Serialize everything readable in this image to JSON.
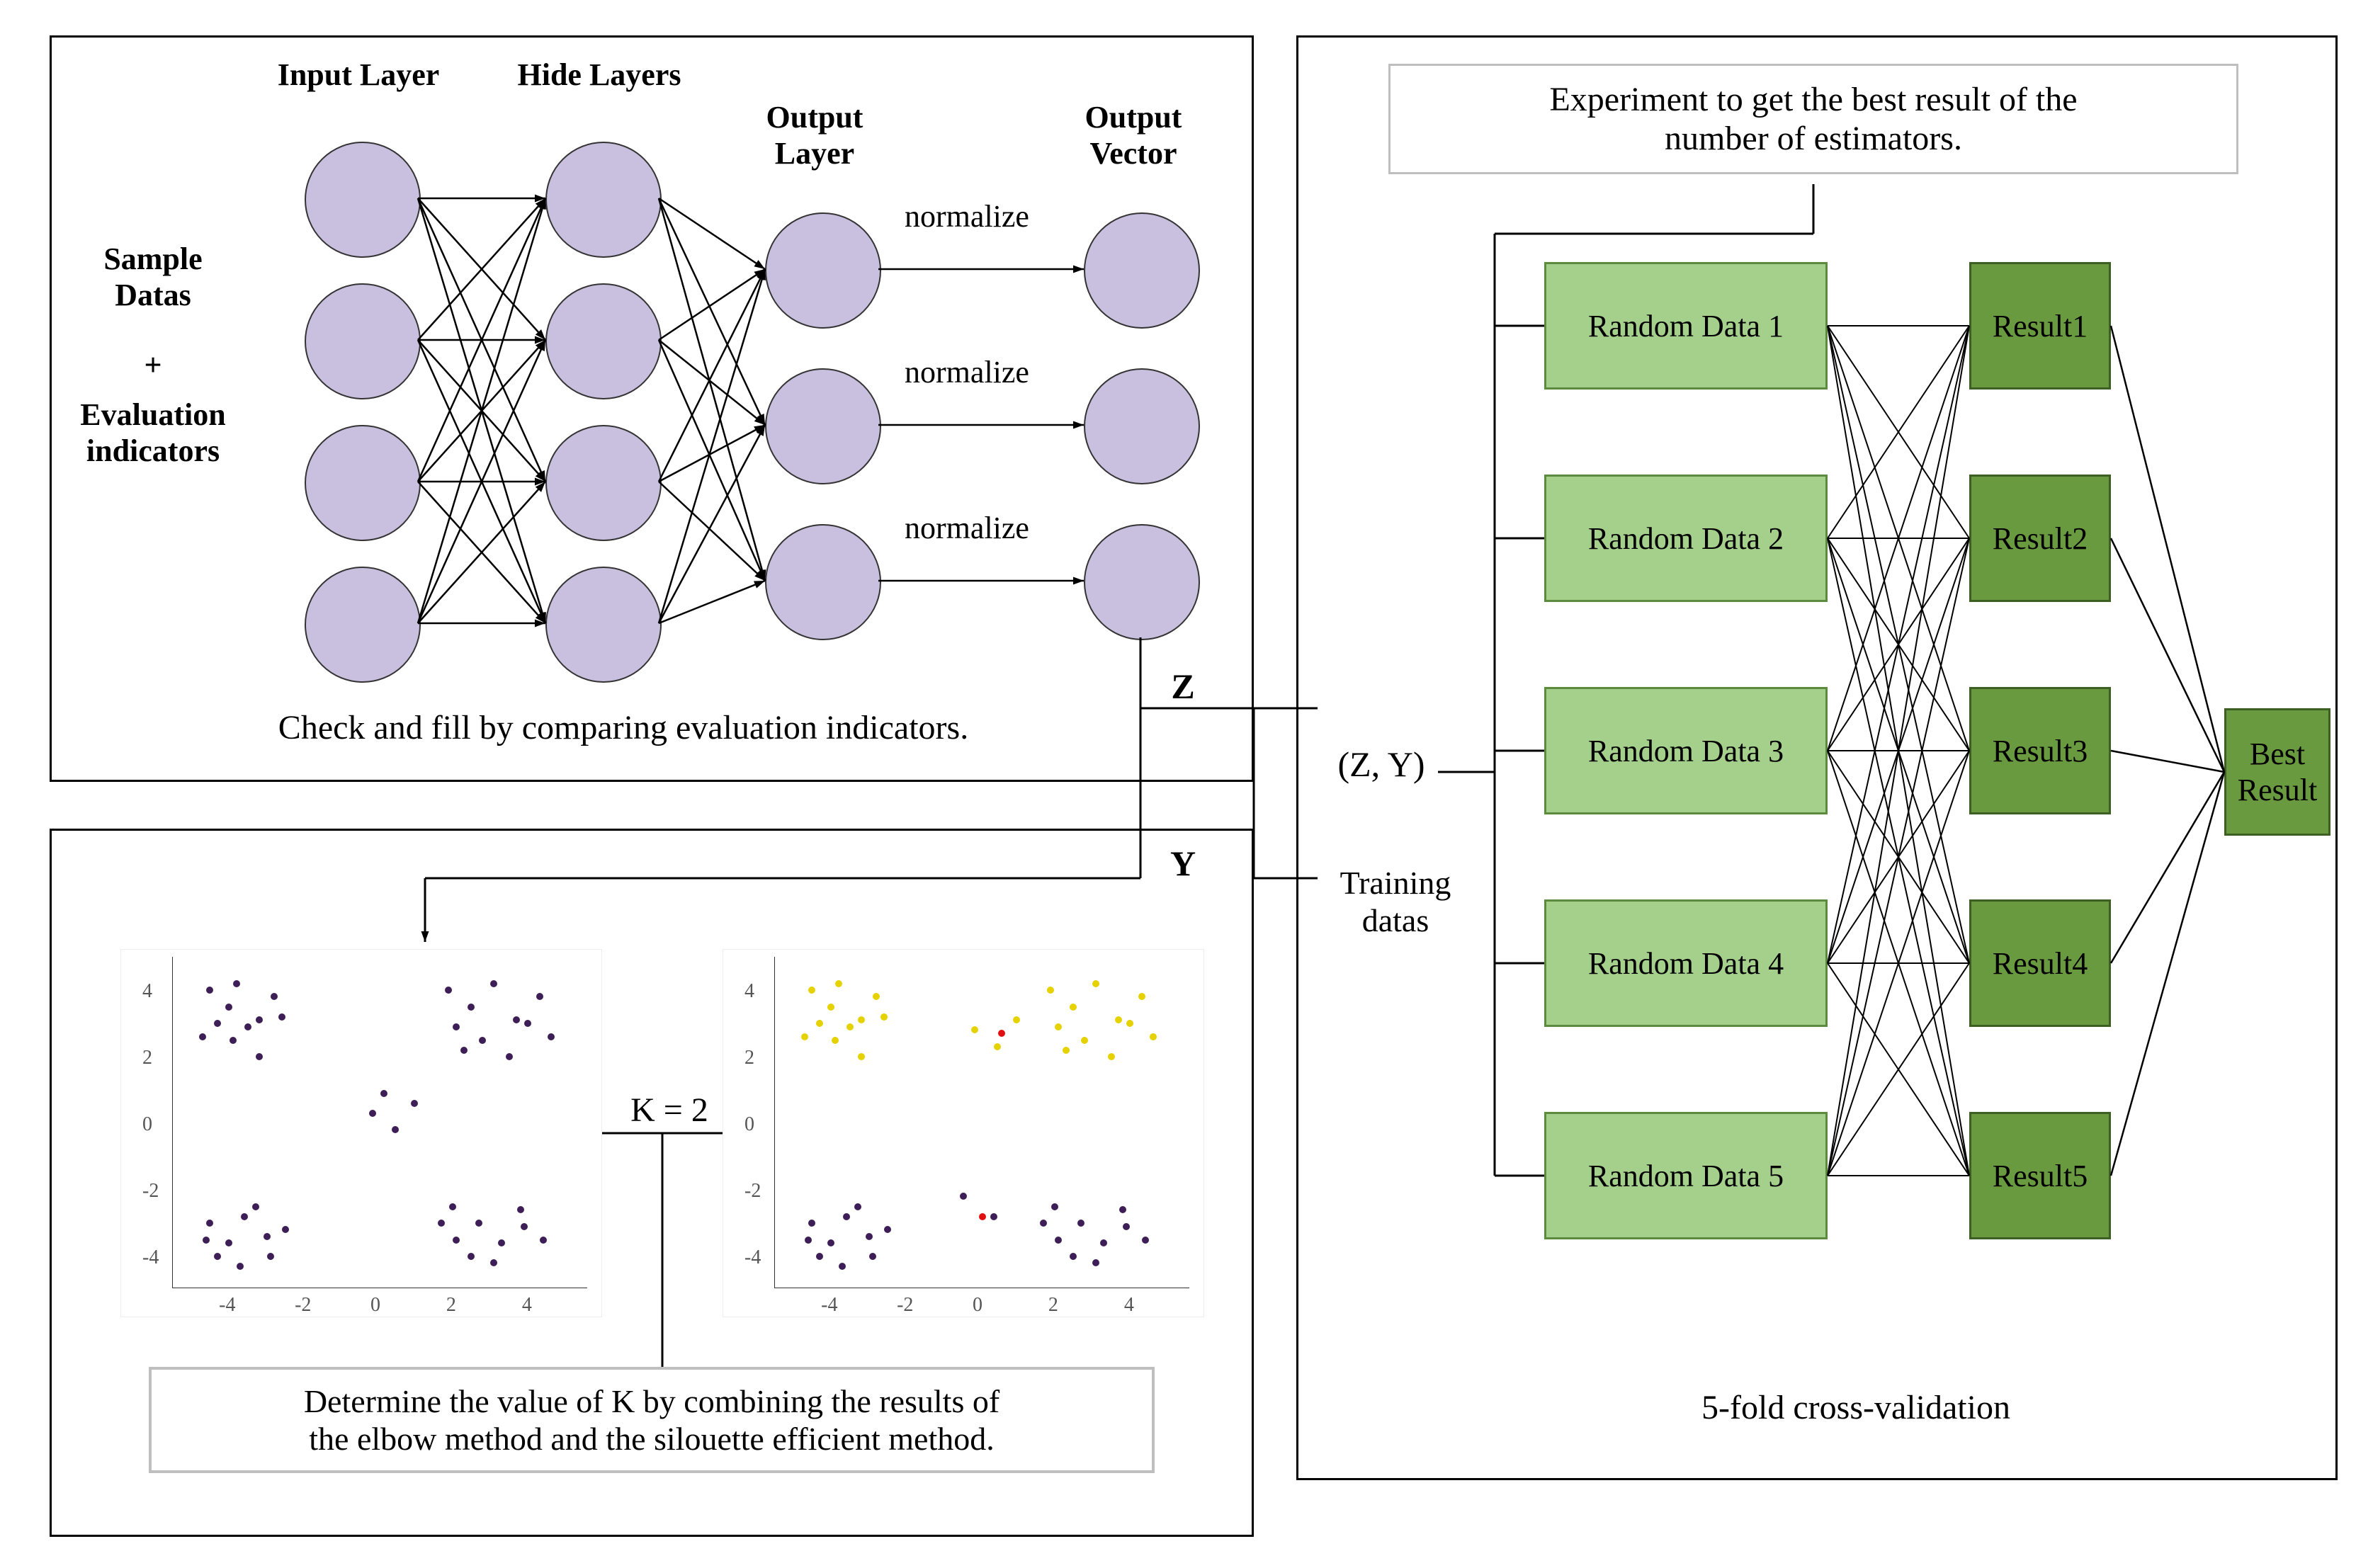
{
  "nn": {
    "inputLabel": "Input Layer",
    "hideLabel": "Hide Layers",
    "outputLabel": "Output\nLayer",
    "vectorLabel": "Output\nVector",
    "sideLabel1": "Sample\nDatas",
    "sideLabel2": "+",
    "sideLabel3": "Evaluation\nindicators",
    "normalize": "normalize",
    "caption": "Check and fill by comparing evaluation indicators.",
    "zLabel": "Z"
  },
  "cluster": {
    "kLabel": "K = 2",
    "caption": "Determine the value of K by combining the results of\nthe elbow method and the silouette efficient method.",
    "yLabel": "Y",
    "xticks": [
      "-4",
      "-2",
      "0",
      "2",
      "4"
    ],
    "yticks": [
      "-4",
      "-2",
      "0",
      "2",
      "4"
    ],
    "scatter1": {
      "purple": [
        [
          -4.5,
          4
        ],
        [
          -4,
          3.5
        ],
        [
          -3.8,
          4.2
        ],
        [
          -3.2,
          3.1
        ],
        [
          -4.3,
          3.0
        ],
        [
          -3.5,
          2.9
        ],
        [
          -2.8,
          3.8
        ],
        [
          -4.7,
          2.6
        ],
        [
          -3.9,
          2.5
        ],
        [
          -3.2,
          2.0
        ],
        [
          -2.6,
          3.2
        ],
        [
          1.8,
          4.0
        ],
        [
          2.4,
          3.5
        ],
        [
          3.0,
          4.2
        ],
        [
          3.6,
          3.1
        ],
        [
          2.0,
          2.9
        ],
        [
          2.7,
          2.5
        ],
        [
          3.4,
          2.0
        ],
        [
          4.2,
          3.8
        ],
        [
          3.9,
          3.0
        ],
        [
          2.2,
          2.2
        ],
        [
          4.5,
          2.6
        ],
        [
          -4.5,
          -3.0
        ],
        [
          -4.0,
          -3.6
        ],
        [
          -3.6,
          -2.8
        ],
        [
          -3.0,
          -3.4
        ],
        [
          -4.3,
          -4.0
        ],
        [
          -3.7,
          -4.3
        ],
        [
          -2.9,
          -4.0
        ],
        [
          -2.5,
          -3.2
        ],
        [
          -3.3,
          -2.5
        ],
        [
          -4.6,
          -3.5
        ],
        [
          1.6,
          -3.0
        ],
        [
          2.0,
          -3.5
        ],
        [
          2.6,
          -3.0
        ],
        [
          3.2,
          -3.6
        ],
        [
          3.8,
          -3.1
        ],
        [
          4.3,
          -3.5
        ],
        [
          2.4,
          -4.0
        ],
        [
          3.0,
          -4.2
        ],
        [
          3.7,
          -2.6
        ],
        [
          1.9,
          -2.5
        ],
        [
          -0.2,
          0.3
        ],
        [
          0.4,
          -0.2
        ],
        [
          0.9,
          0.6
        ],
        [
          0.1,
          0.9
        ]
      ]
    },
    "scatter2": {
      "yellow": [
        [
          -4.5,
          4
        ],
        [
          -4,
          3.5
        ],
        [
          -3.8,
          4.2
        ],
        [
          -3.2,
          3.1
        ],
        [
          -4.3,
          3.0
        ],
        [
          -3.5,
          2.9
        ],
        [
          -2.8,
          3.8
        ],
        [
          -4.7,
          2.6
        ],
        [
          -3.9,
          2.5
        ],
        [
          -3.2,
          2.0
        ],
        [
          -2.6,
          3.2
        ],
        [
          1.8,
          4.0
        ],
        [
          2.4,
          3.5
        ],
        [
          3.0,
          4.2
        ],
        [
          3.6,
          3.1
        ],
        [
          2.0,
          2.9
        ],
        [
          2.7,
          2.5
        ],
        [
          3.4,
          2.0
        ],
        [
          4.2,
          3.8
        ],
        [
          3.9,
          3.0
        ],
        [
          2.2,
          2.2
        ],
        [
          4.5,
          2.6
        ],
        [
          -0.2,
          2.8
        ],
        [
          0.4,
          2.3
        ],
        [
          0.9,
          3.1
        ]
      ],
      "purple": [
        [
          -4.5,
          -3.0
        ],
        [
          -4.0,
          -3.6
        ],
        [
          -3.6,
          -2.8
        ],
        [
          -3.0,
          -3.4
        ],
        [
          -4.3,
          -4.0
        ],
        [
          -3.7,
          -4.3
        ],
        [
          -2.9,
          -4.0
        ],
        [
          -2.5,
          -3.2
        ],
        [
          -3.3,
          -2.5
        ],
        [
          -4.6,
          -3.5
        ],
        [
          1.6,
          -3.0
        ],
        [
          2.0,
          -3.5
        ],
        [
          2.6,
          -3.0
        ],
        [
          3.2,
          -3.6
        ],
        [
          3.8,
          -3.1
        ],
        [
          4.3,
          -3.5
        ],
        [
          2.4,
          -4.0
        ],
        [
          3.0,
          -4.2
        ],
        [
          3.7,
          -2.6
        ],
        [
          1.9,
          -2.5
        ],
        [
          -0.5,
          -2.2
        ],
        [
          0.3,
          -2.8
        ]
      ],
      "red": [
        [
          0.5,
          2.7
        ],
        [
          0.0,
          -2.8
        ]
      ]
    }
  },
  "right": {
    "title": "Experiment to get the best result of the\nnumber of estimators.",
    "zy": "(Z, Y)",
    "training": "Training\ndatas",
    "randoms": [
      "Random Data 1",
      "Random Data 2",
      "Random Data 3",
      "Random Data 4",
      "Random Data 5"
    ],
    "results": [
      "Result1",
      "Result2",
      "Result3",
      "Result4",
      "Result5"
    ],
    "best": "Best\nResult",
    "caption": "5-fold cross-validation"
  }
}
